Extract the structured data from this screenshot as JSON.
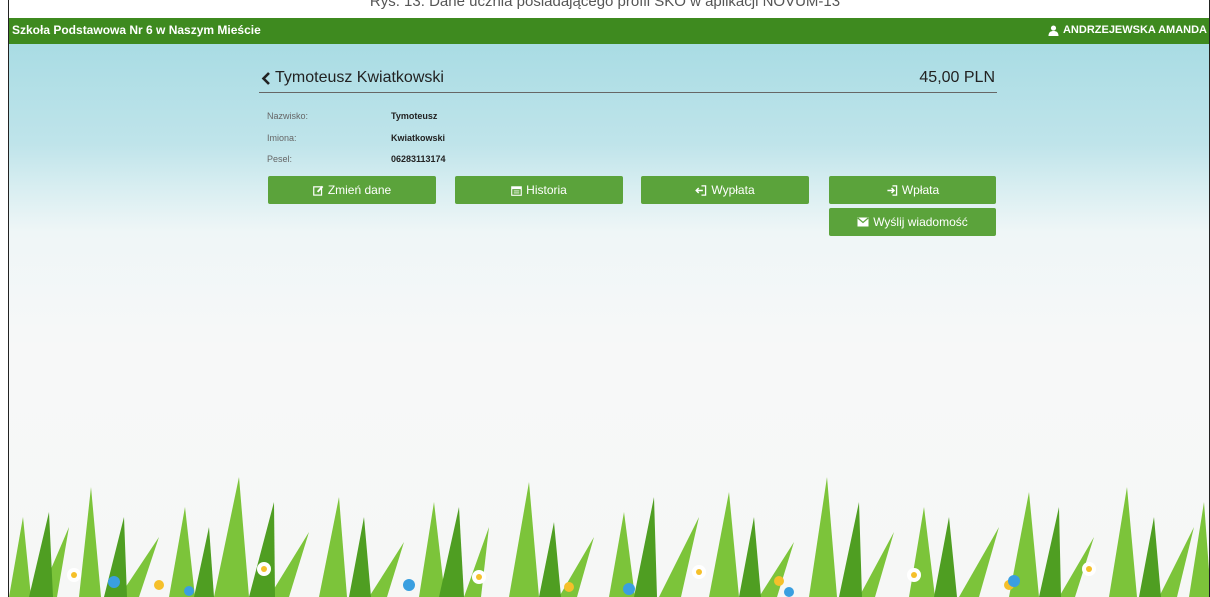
{
  "caption": "Rys. 13. Dane ucznia posiadającego profil SKO w aplikacji NOVUM-13",
  "header": {
    "school_name": "Szkoła Podstawowa Nr 6 w Naszym Mieście",
    "user_name": "ANDRZEJEWSKA AMANDA",
    "user_icon": "user-icon"
  },
  "student": {
    "full_name": "Tymoteusz Kwiatkowski",
    "balance": "45,00 PLN"
  },
  "details": [
    {
      "label": "Nazwisko:",
      "value": "Tymoteusz"
    },
    {
      "label": "Imiona:",
      "value": "Kwiatkowski"
    },
    {
      "label": "Pesel:",
      "value": "06283113174"
    }
  ],
  "actions": {
    "edit": {
      "label": "Zmień dane",
      "icon": "edit-icon"
    },
    "history": {
      "label": "Historia",
      "icon": "calendar-icon"
    },
    "withdraw": {
      "label": "Wypłata",
      "icon": "sign-out-icon"
    },
    "deposit": {
      "label": "Wpłata",
      "icon": "sign-in-icon"
    },
    "message": {
      "label": "Wyślij wiadomość",
      "icon": "envelope-icon"
    }
  },
  "colors": {
    "topbar": "#3e8a1f",
    "button": "#5ba33b",
    "sky": "#a9dce4"
  }
}
